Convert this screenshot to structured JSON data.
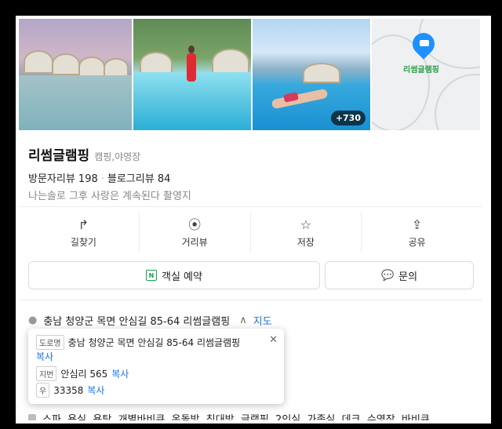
{
  "photos": {
    "more_count": "+730"
  },
  "map": {
    "label": "리썸글램핑",
    "pin_icon": "bed-pin-icon"
  },
  "place": {
    "name": "리썸글램핑",
    "category": "캠핑,야영장",
    "visitor_reviews": "방문자리뷰 198",
    "blog_reviews": "블로그리뷰 84",
    "description": "나는솔로 그후 사랑은 계속된다 촬영지"
  },
  "actions": [
    {
      "label": "길찾기",
      "icon": "directions-icon"
    },
    {
      "label": "거리뷰",
      "icon": "streetview-icon"
    },
    {
      "label": "저장",
      "icon": "star-icon"
    },
    {
      "label": "공유",
      "icon": "share-icon"
    }
  ],
  "buttons": {
    "room_reservation": "객실 예약",
    "inquiry": "문의"
  },
  "address": {
    "summary": "충남 청양군 목면 안심길 85-64 리썸글램핑",
    "map_link": "지도",
    "popup": {
      "road_tag": "도로명",
      "road": "충남 청양군 목면 안심길 85-64 리썸글램핑",
      "road_copy": "복사",
      "lot_tag": "지번",
      "lot": "안심리 565",
      "lot_copy": "복사",
      "zip_tag": "우",
      "zip": "33358",
      "zip_copy": "복사"
    }
  },
  "amenities": "스파, 욕실, 욕탕, 개별바비큐, 온돌방, 침대방, 글램핑, 2인실, 가족실, 데크, 수영장, 바비큐..."
}
